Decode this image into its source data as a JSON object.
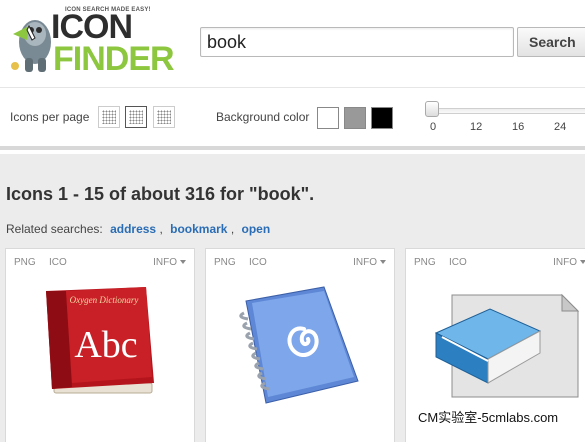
{
  "logo": {
    "tagline": "ICON SEARCH MADE EASY!",
    "word1": "ICON",
    "word2": "FINDER"
  },
  "search": {
    "value": "book",
    "button_label": "Search"
  },
  "options": {
    "per_page_label": "Icons per page",
    "background_label": "Background color",
    "background_colors": [
      "#ffffff",
      "#999999",
      "#000000"
    ],
    "size_ticks": [
      "0",
      "12",
      "16",
      "24"
    ]
  },
  "results": {
    "title": "Icons 1 - 15 of about 316 for \"book\".",
    "related_label": "Related searches:",
    "related_links": [
      "address",
      "bookmark",
      "open"
    ]
  },
  "cards": [
    {
      "png": "PNG",
      "ico": "ICO",
      "info": "INFO",
      "icon_name": "red-dictionary-book-icon",
      "book_title": "Oxygen Dictionary",
      "book_text": "Abc"
    },
    {
      "png": "PNG",
      "ico": "ICO",
      "info": "INFO",
      "icon_name": "blue-spiral-notebook-icon"
    },
    {
      "png": "PNG",
      "ico": "ICO",
      "info": "INFO",
      "icon_name": "blue-book-document-icon"
    }
  ],
  "watermark": "CM实验室-5cmlabs.com"
}
